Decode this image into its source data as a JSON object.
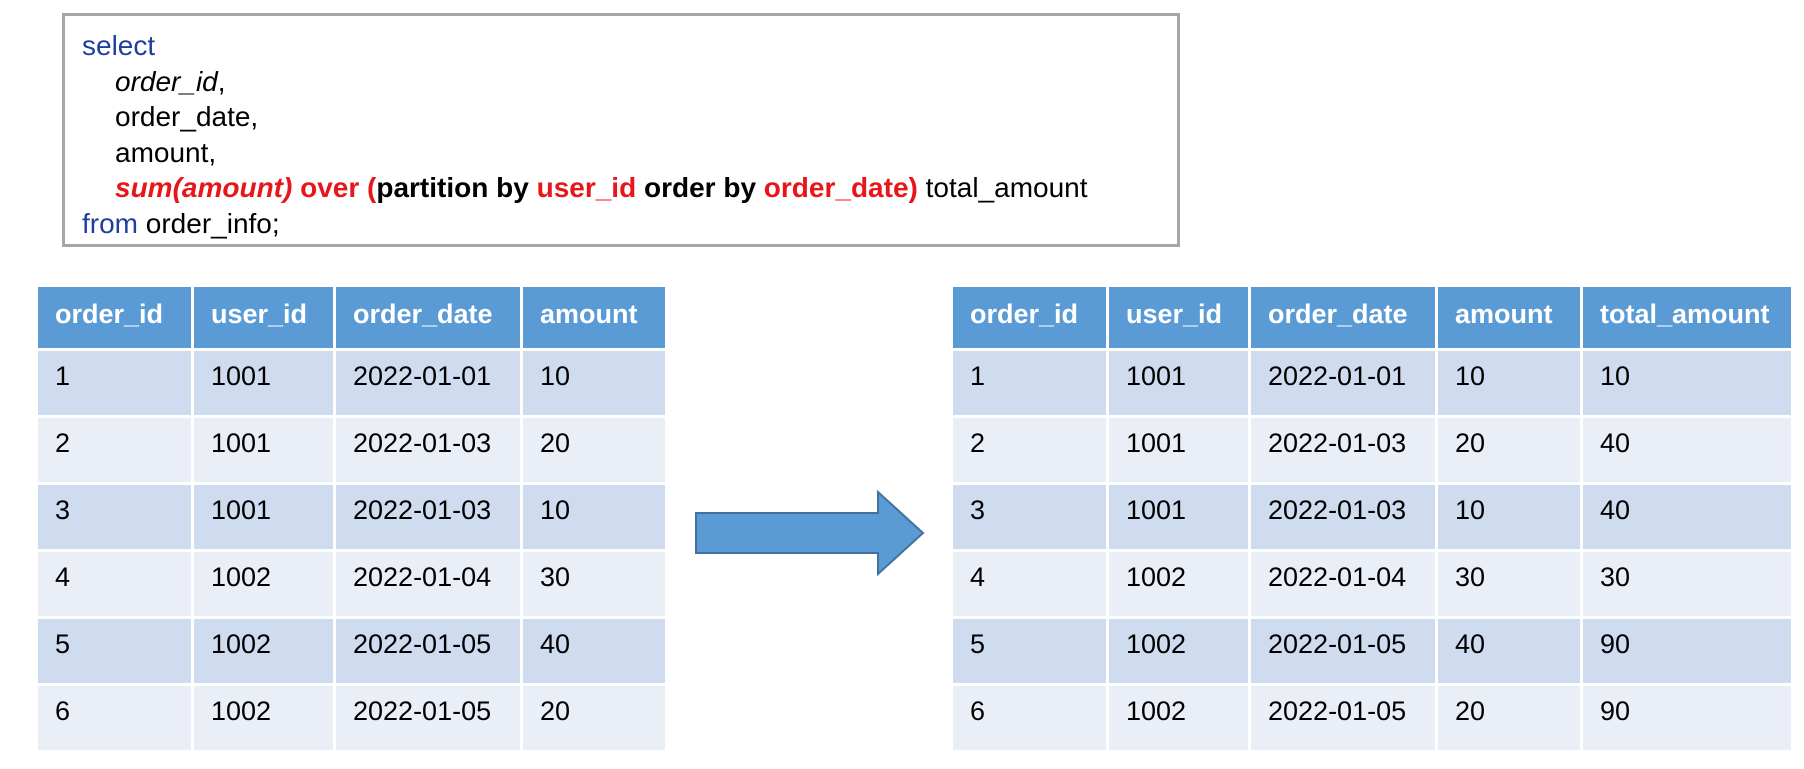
{
  "code": {
    "select_kw": "select",
    "col1": "order_id",
    "col1_comma": ",",
    "col2": "order_date,",
    "col3": "amount,",
    "func": "sum(amount)",
    "over": " over (",
    "partition_by": "partition by ",
    "partition_col": "user_id",
    "order_by": " order by ",
    "order_col": "order_date)",
    "alias": " total_amount",
    "from_kw": "from",
    "table_name": " order_info;"
  },
  "colors": {
    "keyword_blue": "#1f3fa0",
    "highlight_red": "#e8161b",
    "header_blue": "#5b9bd5",
    "row_dark": "#cfdbee",
    "row_light": "#e9eef7",
    "arrow_fill": "#5b9bd5",
    "arrow_stroke": "#41719c"
  },
  "left_table": {
    "headers": [
      "order_id",
      "user_id",
      "order_date",
      "amount"
    ],
    "rows": [
      [
        "1",
        "1001",
        "2022-01-01",
        "10"
      ],
      [
        "2",
        "1001",
        "2022-01-03",
        "20"
      ],
      [
        "3",
        "1001",
        "2022-01-03",
        "10"
      ],
      [
        "4",
        "1002",
        "2022-01-04",
        "30"
      ],
      [
        "5",
        "1002",
        "2022-01-05",
        "40"
      ],
      [
        "6",
        "1002",
        "2022-01-05",
        "20"
      ]
    ]
  },
  "right_table": {
    "headers": [
      "order_id",
      "user_id",
      "order_date",
      "amount",
      "total_amount"
    ],
    "rows": [
      [
        "1",
        "1001",
        "2022-01-01",
        "10",
        "10"
      ],
      [
        "2",
        "1001",
        "2022-01-03",
        "20",
        "40"
      ],
      [
        "3",
        "1001",
        "2022-01-03",
        "10",
        "40"
      ],
      [
        "4",
        "1002",
        "2022-01-04",
        "30",
        "30"
      ],
      [
        "5",
        "1002",
        "2022-01-05",
        "40",
        "90"
      ],
      [
        "6",
        "1002",
        "2022-01-05",
        "20",
        "90"
      ]
    ]
  },
  "arrow_icon": "right-arrow-icon"
}
